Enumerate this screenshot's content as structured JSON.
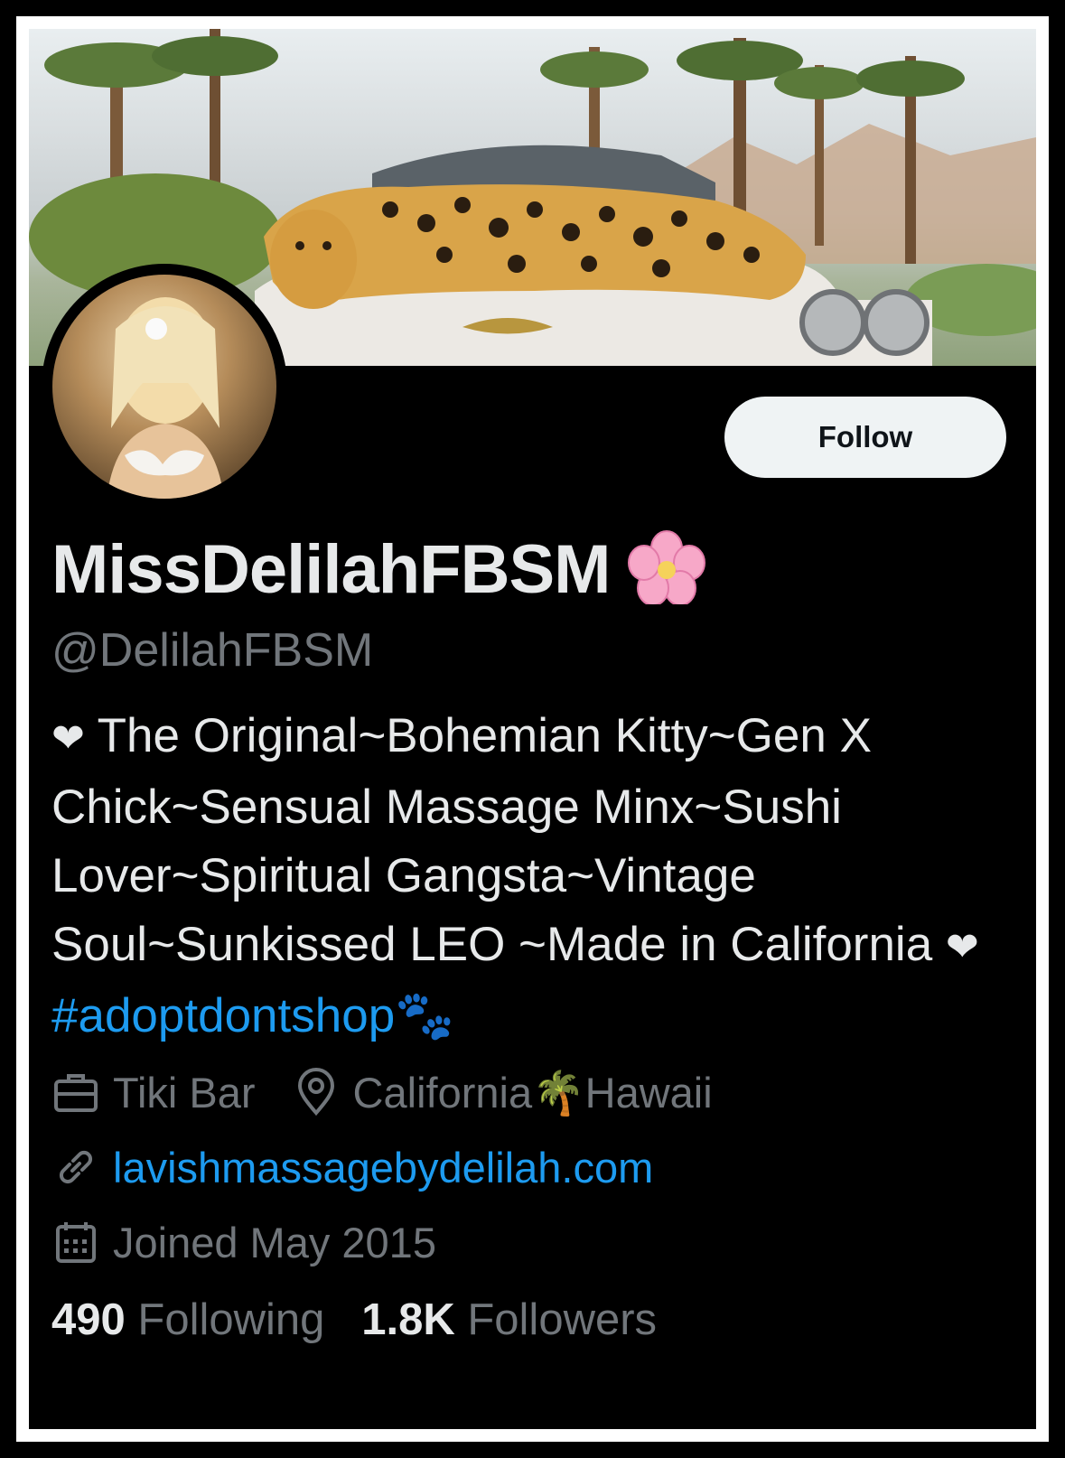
{
  "profile": {
    "display_name": "MissDelilahFBSM",
    "display_name_emoji": "cherry-blossom-icon",
    "handle": "@DelilahFBSM",
    "follow_label": "Follow",
    "bio": {
      "heart_start": "❤",
      "text": " The Original~Bohemian Kitty~Gen X Chick~Sensual Massage Minx~Sushi Lover~Spiritual Gangsta~Vintage Soul~Sunkissed LEO ~Made in California ",
      "heart_end": "❤",
      "hashtag": "#adoptdontshop",
      "paw_emoji": "🐾"
    },
    "profession": "Tiki Bar",
    "location_a": "California",
    "location_emoji": "🌴",
    "location_b": "Hawaii",
    "website": "lavishmassagebydelilah.com",
    "joined": "Joined May 2015",
    "following_count": "490",
    "following_label": "Following",
    "followers_count": "1.8K",
    "followers_label": "Followers"
  },
  "colors": {
    "background": "#000000",
    "text_primary": "#e7e9ea",
    "text_secondary": "#71767b",
    "link": "#1d9bf0",
    "button_bg": "#eff3f4"
  }
}
